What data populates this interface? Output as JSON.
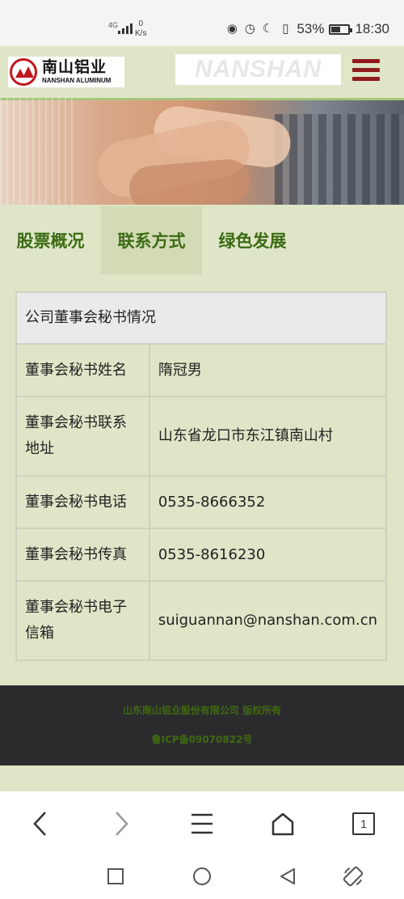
{
  "status_bar": {
    "network": "4G",
    "speed_value": "0",
    "speed_unit": "K/s",
    "battery": "53%",
    "battery_level": 0.53,
    "time": "18:30"
  },
  "header": {
    "logo_cn": "南山铝业",
    "logo_en": "NANSHAN ALUMINUM",
    "banner_text": "NANSHAN"
  },
  "tabs": [
    {
      "label": "股票概况"
    },
    {
      "label": "联系方式"
    },
    {
      "label": "绿色发展"
    }
  ],
  "table": {
    "title": "公司董事会秘书情况",
    "rows": [
      {
        "label": "董事会秘书姓名",
        "value": "隋冠男"
      },
      {
        "label": "董事会秘书联系地址",
        "value": "山东省龙口市东江镇南山村"
      },
      {
        "label": "董事会秘书电话",
        "value": "0535-8666352"
      },
      {
        "label": "董事会秘书传真",
        "value": "0535-8616230"
      },
      {
        "label": "董事会秘书电子信箱",
        "value": "suiguannan@nanshan.com.cn"
      }
    ]
  },
  "footer": {
    "copyright": "山东南山铝业股份有限公司 版权所有",
    "icp": "鲁ICP备09070822号"
  },
  "browser_nav": {
    "tab_count": "1"
  },
  "colors": {
    "page_bg": "#dfe6c8",
    "tab_text": "#3c6b14",
    "menu_icon": "#8f1a1c",
    "footer_bg": "#2b2b2d"
  }
}
